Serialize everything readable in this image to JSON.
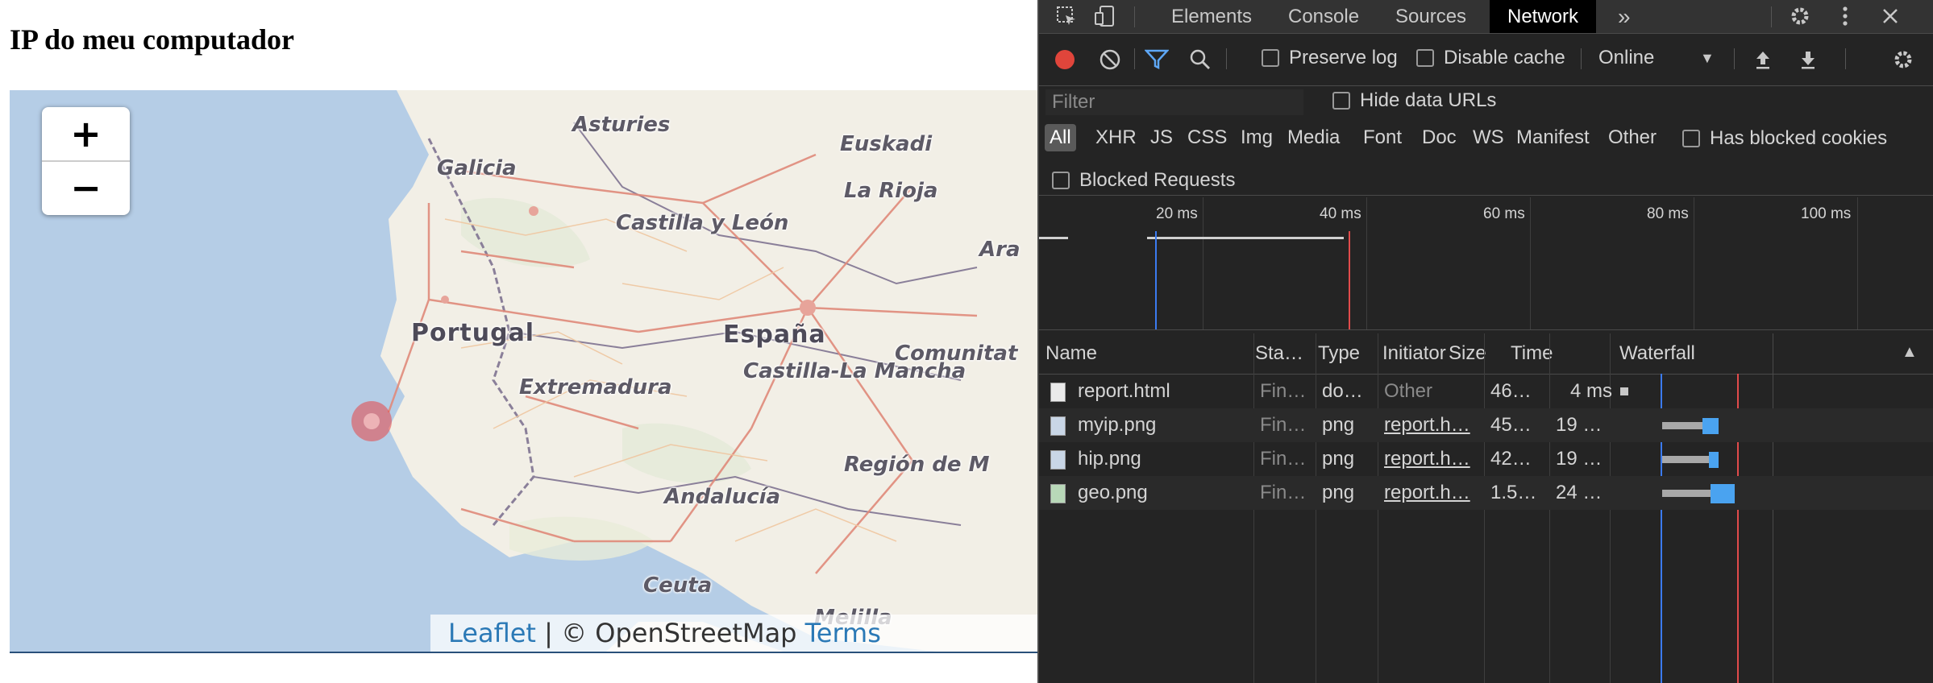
{
  "page": {
    "title": "IP do meu computador"
  },
  "map": {
    "zoom_in": "+",
    "zoom_out": "−",
    "labels": {
      "asturies": "Asturies",
      "euskadi": "Euskadi",
      "galicia": "Galicia",
      "la_rioja": "La Rioja",
      "castilla_leon": "Castilla y León",
      "ara": "Ara",
      "portugal": "Portugal",
      "espana": "España",
      "comunitat": "Comunitat",
      "castilla_mancha": "Castilla-La Mancha",
      "extremadura": "Extremadura",
      "region_de": "Región de M",
      "andalucia": "Andalucía",
      "ceuta": "Ceuta",
      "melilla": "Melilla"
    },
    "attribution": {
      "leaflet": "Leaflet",
      "separator": "|",
      "osm": "© OpenStreetMap",
      "terms": "Terms"
    }
  },
  "devtools": {
    "tabs": [
      "Elements",
      "Console",
      "Sources",
      "Network"
    ],
    "active_tab": "Network",
    "more_tabs": "»",
    "toolbar": {
      "preserve_log": "Preserve log",
      "disable_cache": "Disable cache",
      "throttling": "Online"
    },
    "filter": {
      "placeholder": "Filter",
      "hide_data_urls": "Hide data URLs"
    },
    "types": [
      "All",
      "XHR",
      "JS",
      "CSS",
      "Img",
      "Media",
      "Font",
      "Doc",
      "WS",
      "Manifest",
      "Other"
    ],
    "has_blocked_cookies": "Has blocked cookies",
    "blocked_requests": "Blocked Requests",
    "overview_ticks": [
      "20 ms",
      "40 ms",
      "60 ms",
      "80 ms",
      "100 ms"
    ],
    "columns": [
      "Name",
      "Sta…",
      "Type",
      "Initiator",
      "Size",
      "Time",
      "Waterfall"
    ],
    "sort_indicator": "▲",
    "requests": [
      {
        "name": "report.html",
        "status": "Fin…",
        "type": "do…",
        "initiator": "Other",
        "size": "46…",
        "time": "4 ms"
      },
      {
        "name": "myip.png",
        "status": "Fin…",
        "type": "png",
        "initiator": "report.h…",
        "size": "45…",
        "time": "19 …"
      },
      {
        "name": "hip.png",
        "status": "Fin…",
        "type": "png",
        "initiator": "report.h…",
        "size": "42…",
        "time": "19 …"
      },
      {
        "name": "geo.png",
        "status": "Fin…",
        "type": "png",
        "initiator": "report.h…",
        "size": "1.5…",
        "time": "24 …"
      }
    ],
    "colors": {
      "record": "#e0453b",
      "filter_active": "#5ea7f5",
      "waterfall_bar": "#4aa3f0",
      "dom_line": "#3b7bf0",
      "load_line": "#e14b4b"
    }
  }
}
